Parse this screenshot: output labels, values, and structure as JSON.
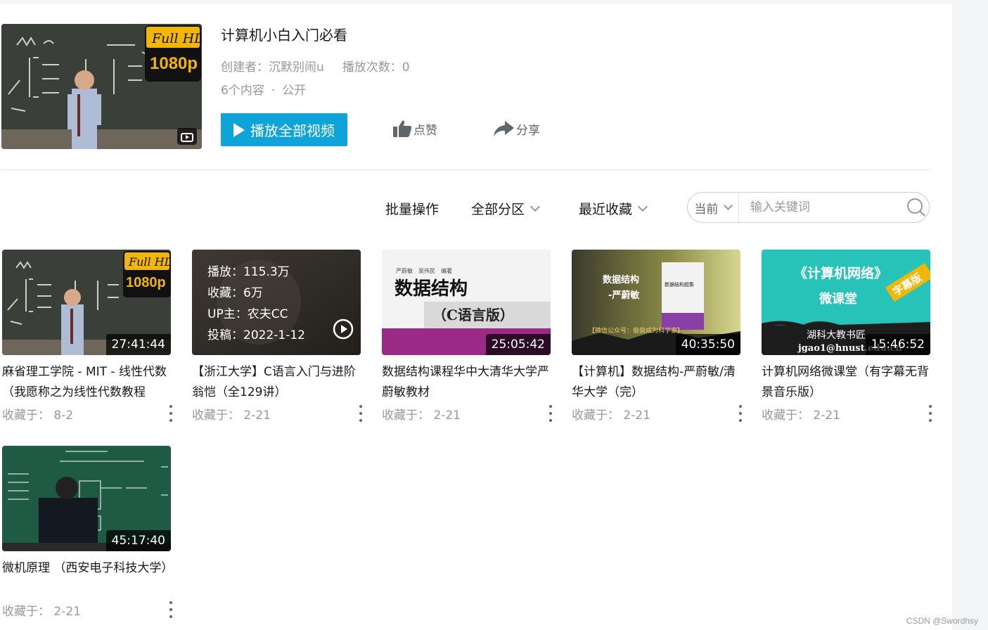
{
  "folder": {
    "title": "计算机小白入门必看",
    "creator_label": "创建者：",
    "creator": "沉默别闹u",
    "plays_label": "播放次数：",
    "plays": "0",
    "count": "6个内容",
    "sep": "·",
    "visibility": "公开",
    "play_all": "播放全部视频",
    "like": "点赞",
    "share": "分享",
    "cover_badge_top": "Full HD",
    "cover_badge_bottom": "1080p"
  },
  "toolbar": {
    "batch": "批量操作",
    "zone": "全部分区",
    "sort": "最近收藏",
    "scope": "当前",
    "search_placeholder": "输入关键词"
  },
  "cards": [
    {
      "title": "麻省理工学院 - MIT - 线性代数（我愿称之为线性代数教程",
      "duration": "27:41:44",
      "fav_label": "收藏于：",
      "fav_date": "8-2",
      "badge_top": "Full HD",
      "badge_bottom": "1080p"
    },
    {
      "title": "【浙江大学】C语言入门与进阶 翁恺（全129讲）",
      "duration": "",
      "fav_label": "收藏于：",
      "fav_date": "2-21",
      "hover": {
        "plays": "播放：115.3万",
        "favs": "收藏：6万",
        "up": "UP主：农夫CC",
        "posted": "投稿：2022-1-12"
      }
    },
    {
      "title": "数据结构课程华中大清华大学严蔚敏教材",
      "duration": "25:05:42",
      "fav_label": "收藏于：",
      "fav_date": "2-21",
      "cover_authors": "严蔚敏　吴伟民　编著",
      "cover_title": "数据结构",
      "cover_sub": "（C语言版）"
    },
    {
      "title": "【计算机】数据结构-严蔚敏/清华大学（完）",
      "duration": "40:35:50",
      "fav_label": "收藏于：",
      "fav_date": "2-21",
      "cover_title": "数据结构",
      "cover_sub": "-严蔚敏",
      "cover_foot": "【微信公众号：偷偷成为科学家】",
      "book_title": "数据结构题集"
    },
    {
      "title": "计算机网络微课堂（有字幕无背景音乐版）",
      "duration": "15:46:52",
      "fav_label": "收藏于：",
      "fav_date": "2-21",
      "cover_title": "《计算机网络》",
      "cover_sub": "微课堂",
      "cover_tag": "字幕版",
      "cover_foot1": "湖科大教书匠",
      "cover_foot2": "jgao1@hnust.edu.cn"
    },
    {
      "title": "微机原理 （西安电子科技大学）",
      "duration": "45:17:40",
      "fav_label": "收藏于：",
      "fav_date": "2-21"
    }
  ],
  "watermark": "CSDN @Swordhsy",
  "colors": {
    "accent": "#0ea4da",
    "muted": "#9499a0",
    "text": "#18191c"
  }
}
